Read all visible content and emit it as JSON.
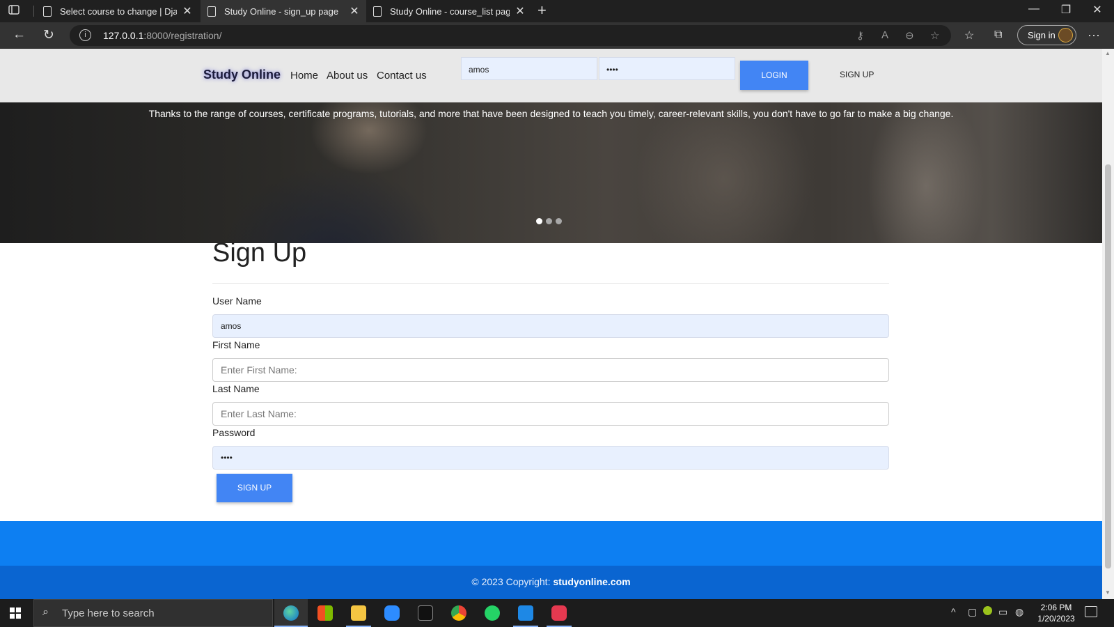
{
  "browser": {
    "tabs": [
      {
        "title": "Select course to change | Django"
      },
      {
        "title": "Study Online - sign_up page"
      },
      {
        "title": "Study Online - course_list page"
      }
    ],
    "url": {
      "host": "127.0.0.1",
      "path": ":8000/registration/"
    },
    "signin_label": "Sign in"
  },
  "site": {
    "brand": "Study Online",
    "nav": [
      "Home",
      "About us",
      "Contact us"
    ],
    "login_form": {
      "username_value": "amos",
      "password_value": "••••",
      "login_label": "LOGIN"
    },
    "signup_link": "SIGN UP"
  },
  "hero": {
    "text": "Thanks to the range of courses, certificate programs, tutorials, and more that have been designed to teach you timely, career-relevant skills, you don't have to go far to make a big change.",
    "slides": 3,
    "active_slide": 1
  },
  "signup": {
    "title": "Sign Up",
    "fields": [
      {
        "label": "User Name",
        "value": "amos",
        "placeholder": ""
      },
      {
        "label": "First Name",
        "value": "",
        "placeholder": "Enter First Name:"
      },
      {
        "label": "Last Name",
        "value": "",
        "placeholder": "Enter Last Name:"
      },
      {
        "label": "Password",
        "value": "••••",
        "placeholder": ""
      }
    ],
    "submit_label": "SIGN UP"
  },
  "footer": {
    "copyright": "© 2023 Copyright:",
    "site_link": "studyonline.com"
  },
  "taskbar": {
    "search_placeholder": "Type here to search",
    "time": "2:06 PM",
    "date": "1/20/2023"
  },
  "colors": {
    "primary": "#4285f4",
    "footer_band": "#0d7ff2",
    "footer_bar": "#0a65d1"
  }
}
